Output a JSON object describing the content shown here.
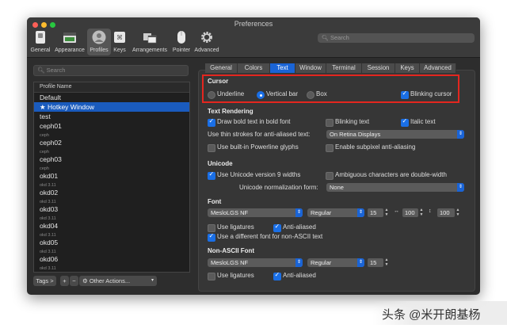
{
  "window": {
    "title": "Preferences"
  },
  "toolbar": {
    "items": [
      {
        "label": "General"
      },
      {
        "label": "Appearance"
      },
      {
        "label": "Profiles"
      },
      {
        "label": "Keys"
      },
      {
        "label": "Arrangements"
      },
      {
        "label": "Pointer"
      },
      {
        "label": "Advanced"
      }
    ],
    "search_placeholder": "Search"
  },
  "profiles": {
    "search_placeholder": "Search",
    "header": "Profile Name",
    "items": [
      {
        "name": "Default",
        "sub": ""
      },
      {
        "name": "★ Hotkey Window",
        "sub": ""
      },
      {
        "name": "test",
        "sub": ""
      },
      {
        "name": "ceph01",
        "sub": "ceph"
      },
      {
        "name": "ceph02",
        "sub": "ceph"
      },
      {
        "name": "ceph03",
        "sub": "ceph"
      },
      {
        "name": "okd01",
        "sub": "okd 3.11"
      },
      {
        "name": "okd02",
        "sub": "okd 3.11"
      },
      {
        "name": "okd03",
        "sub": "okd 3.11"
      },
      {
        "name": "okd04",
        "sub": "okd 3.11"
      },
      {
        "name": "okd05",
        "sub": "okd 3.11"
      },
      {
        "name": "okd06",
        "sub": "okd 3.11"
      }
    ],
    "tags_label": "Tags >",
    "add_label": "+",
    "remove_label": "−",
    "other_actions_label": "Other Actions..."
  },
  "tabs": [
    "General",
    "Colors",
    "Text",
    "Window",
    "Terminal",
    "Session",
    "Keys",
    "Advanced"
  ],
  "cursor": {
    "title": "Cursor",
    "underline": "Underline",
    "vertical_bar": "Vertical bar",
    "box": "Box",
    "blinking": "Blinking cursor"
  },
  "text_rendering": {
    "title": "Text Rendering",
    "bold": "Draw bold text in bold font",
    "blinking_text": "Blinking text",
    "italic": "Italic text",
    "thin_strokes": "Use thin strokes for anti-aliased text:",
    "thin_strokes_value": "On Retina Displays",
    "powerline": "Use built-in Powerline glyphs",
    "subpixel": "Enable subpixel anti-aliasing"
  },
  "unicode": {
    "title": "Unicode",
    "version9": "Use Unicode version 9 widths",
    "ambiguous": "Ambiguous characters are double-width",
    "normalization": "Unicode normalization form:",
    "normalization_value": "None"
  },
  "font": {
    "title": "Font",
    "name": "MesloLGS NF",
    "style": "Regular",
    "size": "15",
    "hspace": "100",
    "vspace": "100",
    "ligatures": "Use ligatures",
    "antialiased": "Anti-aliased",
    "different_nonascii": "Use a different font for non-ASCII text"
  },
  "nonascii_font": {
    "title": "Non-ASCII Font",
    "name": "MesloLGS NF",
    "style": "Regular",
    "size": "15",
    "ligatures": "Use ligatures",
    "antialiased": "Anti-aliased"
  },
  "watermark": "头条 @米开朗基杨"
}
